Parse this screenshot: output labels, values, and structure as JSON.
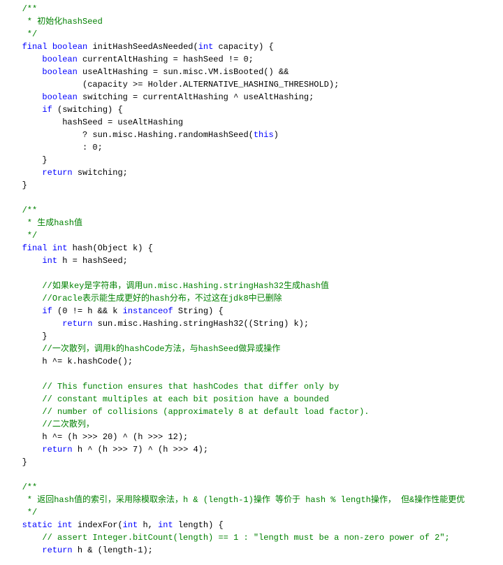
{
  "lines": [
    [
      {
        "cls": "c",
        "txt": "   /**"
      }
    ],
    [
      {
        "cls": "c",
        "txt": "    * 初始化hashSeed"
      }
    ],
    [
      {
        "cls": "c",
        "txt": "    */"
      }
    ],
    [
      {
        "cls": "t",
        "txt": "   "
      },
      {
        "cls": "k",
        "txt": "final"
      },
      {
        "cls": "t",
        "txt": " "
      },
      {
        "cls": "k",
        "txt": "boolean"
      },
      {
        "cls": "t",
        "txt": " initHashSeedAsNeeded("
      },
      {
        "cls": "k",
        "txt": "int"
      },
      {
        "cls": "t",
        "txt": " capacity) {"
      }
    ],
    [
      {
        "cls": "t",
        "txt": "       "
      },
      {
        "cls": "k",
        "txt": "boolean"
      },
      {
        "cls": "t",
        "txt": " currentAltHashing = hashSeed != 0;"
      }
    ],
    [
      {
        "cls": "t",
        "txt": "       "
      },
      {
        "cls": "k",
        "txt": "boolean"
      },
      {
        "cls": "t",
        "txt": " useAltHashing = sun.misc.VM.isBooted() &&"
      }
    ],
    [
      {
        "cls": "t",
        "txt": "               (capacity >= Holder.ALTERNATIVE_HASHING_THRESHOLD);"
      }
    ],
    [
      {
        "cls": "t",
        "txt": "       "
      },
      {
        "cls": "k",
        "txt": "boolean"
      },
      {
        "cls": "t",
        "txt": " switching = currentAltHashing ^ useAltHashing;"
      }
    ],
    [
      {
        "cls": "t",
        "txt": "       "
      },
      {
        "cls": "k",
        "txt": "if"
      },
      {
        "cls": "t",
        "txt": " (switching) {"
      }
    ],
    [
      {
        "cls": "t",
        "txt": "           hashSeed = useAltHashing"
      }
    ],
    [
      {
        "cls": "t",
        "txt": "               ? sun.misc.Hashing.randomHashSeed("
      },
      {
        "cls": "k",
        "txt": "this"
      },
      {
        "cls": "t",
        "txt": ")"
      }
    ],
    [
      {
        "cls": "t",
        "txt": "               : 0;"
      }
    ],
    [
      {
        "cls": "t",
        "txt": "       }"
      }
    ],
    [
      {
        "cls": "t",
        "txt": "       "
      },
      {
        "cls": "k",
        "txt": "return"
      },
      {
        "cls": "t",
        "txt": " switching;"
      }
    ],
    [
      {
        "cls": "t",
        "txt": "   }"
      }
    ],
    [
      {
        "cls": "t",
        "txt": ""
      }
    ],
    [
      {
        "cls": "c",
        "txt": "   /**"
      }
    ],
    [
      {
        "cls": "c",
        "txt": "    * 生成hash值"
      }
    ],
    [
      {
        "cls": "c",
        "txt": "    */"
      }
    ],
    [
      {
        "cls": "t",
        "txt": "   "
      },
      {
        "cls": "k",
        "txt": "final"
      },
      {
        "cls": "t",
        "txt": " "
      },
      {
        "cls": "k",
        "txt": "int"
      },
      {
        "cls": "t",
        "txt": " hash(Object k) {"
      }
    ],
    [
      {
        "cls": "t",
        "txt": "       "
      },
      {
        "cls": "k",
        "txt": "int"
      },
      {
        "cls": "t",
        "txt": " h = hashSeed;"
      }
    ],
    [
      {
        "cls": "t",
        "txt": ""
      }
    ],
    [
      {
        "cls": "t",
        "txt": "       "
      },
      {
        "cls": "c",
        "txt": "//如果key是字符串，调用un.misc.Hashing.stringHash32生成hash值"
      }
    ],
    [
      {
        "cls": "t",
        "txt": "       "
      },
      {
        "cls": "c",
        "txt": "//Oracle表示能生成更好的hash分布，不过这在jdk8中已删除"
      }
    ],
    [
      {
        "cls": "t",
        "txt": "       "
      },
      {
        "cls": "k",
        "txt": "if"
      },
      {
        "cls": "t",
        "txt": " (0 != h && k "
      },
      {
        "cls": "k",
        "txt": "instanceof"
      },
      {
        "cls": "t",
        "txt": " String) {"
      }
    ],
    [
      {
        "cls": "t",
        "txt": "           "
      },
      {
        "cls": "k",
        "txt": "return"
      },
      {
        "cls": "t",
        "txt": " sun.misc.Hashing.stringHash32((String) k);"
      }
    ],
    [
      {
        "cls": "t",
        "txt": "       }"
      }
    ],
    [
      {
        "cls": "t",
        "txt": "       "
      },
      {
        "cls": "c",
        "txt": "//一次散列，调用k的hashCode方法，与hashSeed做异或操作"
      }
    ],
    [
      {
        "cls": "t",
        "txt": "       h ^= k.hashCode();"
      }
    ],
    [
      {
        "cls": "t",
        "txt": ""
      }
    ],
    [
      {
        "cls": "t",
        "txt": "       "
      },
      {
        "cls": "c",
        "txt": "// This function ensures that hashCodes that differ only by"
      }
    ],
    [
      {
        "cls": "t",
        "txt": "       "
      },
      {
        "cls": "c",
        "txt": "// constant multiples at each bit position have a bounded"
      }
    ],
    [
      {
        "cls": "t",
        "txt": "       "
      },
      {
        "cls": "c",
        "txt": "// number of collisions (approximately 8 at default load factor)."
      }
    ],
    [
      {
        "cls": "t",
        "txt": "       "
      },
      {
        "cls": "c",
        "txt": "//二次散列，"
      }
    ],
    [
      {
        "cls": "t",
        "txt": "       h ^= (h >>> 20) ^ (h >>> 12);"
      }
    ],
    [
      {
        "cls": "t",
        "txt": "       "
      },
      {
        "cls": "k",
        "txt": "return"
      },
      {
        "cls": "t",
        "txt": " h ^ (h >>> 7) ^ (h >>> 4);"
      }
    ],
    [
      {
        "cls": "t",
        "txt": "   }"
      }
    ],
    [
      {
        "cls": "t",
        "txt": ""
      }
    ],
    [
      {
        "cls": "c",
        "txt": "   /**"
      }
    ],
    [
      {
        "cls": "c",
        "txt": "    * 返回hash值的索引，采用除模取余法，h & (length-1)操作 等价于 hash % length操作， 但&操作性能更优"
      }
    ],
    [
      {
        "cls": "c",
        "txt": "    */"
      }
    ],
    [
      {
        "cls": "t",
        "txt": "   "
      },
      {
        "cls": "k",
        "txt": "static"
      },
      {
        "cls": "t",
        "txt": " "
      },
      {
        "cls": "k",
        "txt": "int"
      },
      {
        "cls": "t",
        "txt": " indexFor("
      },
      {
        "cls": "k",
        "txt": "int"
      },
      {
        "cls": "t",
        "txt": " h, "
      },
      {
        "cls": "k",
        "txt": "int"
      },
      {
        "cls": "t",
        "txt": " length) {"
      }
    ],
    [
      {
        "cls": "t",
        "txt": "       "
      },
      {
        "cls": "c",
        "txt": "// assert Integer.bitCount(length) == 1 : \"length must be a non-zero power of 2\";"
      }
    ],
    [
      {
        "cls": "t",
        "txt": "       "
      },
      {
        "cls": "k",
        "txt": "return"
      },
      {
        "cls": "t",
        "txt": " h & (length-1);"
      }
    ],
    []
  ]
}
